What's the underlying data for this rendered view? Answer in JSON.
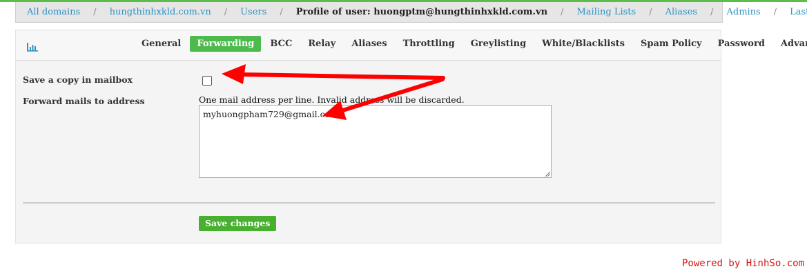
{
  "breadcrumb": {
    "items": [
      {
        "label": "All domains"
      },
      {
        "label": "hungthinhxkld.com.vn"
      },
      {
        "label": "Users"
      },
      {
        "label": "Profile of user: huongptm@hungthinhxkld.com.vn"
      },
      {
        "label": "Mailing Lists"
      },
      {
        "label": "Aliases"
      },
      {
        "label": "Admins"
      },
      {
        "label": "Last Logins"
      }
    ],
    "separator": "/"
  },
  "tabs": [
    {
      "label": "General"
    },
    {
      "label": "Forwarding",
      "active": true
    },
    {
      "label": "BCC"
    },
    {
      "label": "Relay"
    },
    {
      "label": "Aliases"
    },
    {
      "label": "Throttling"
    },
    {
      "label": "Greylisting"
    },
    {
      "label": "White/Blacklists"
    },
    {
      "label": "Spam Policy"
    },
    {
      "label": "Password"
    },
    {
      "label": "Advanced"
    }
  ],
  "form": {
    "save_copy_label": "Save a copy in mailbox",
    "save_copy_checked": false,
    "forward_label": "Forward mails to address",
    "forward_hint": "One mail address per line. Invalid address will be discarded.",
    "forward_value": "myhuongpham729@gmail.com",
    "save_button": "Save changes"
  },
  "watermark": "Powered by HinhSo.com",
  "colors": {
    "accent_green": "#4cbb4c",
    "link_blue": "#2d92c4",
    "annotation_red": "#ff0000"
  },
  "icons": {
    "stats": "bar-chart-icon"
  }
}
